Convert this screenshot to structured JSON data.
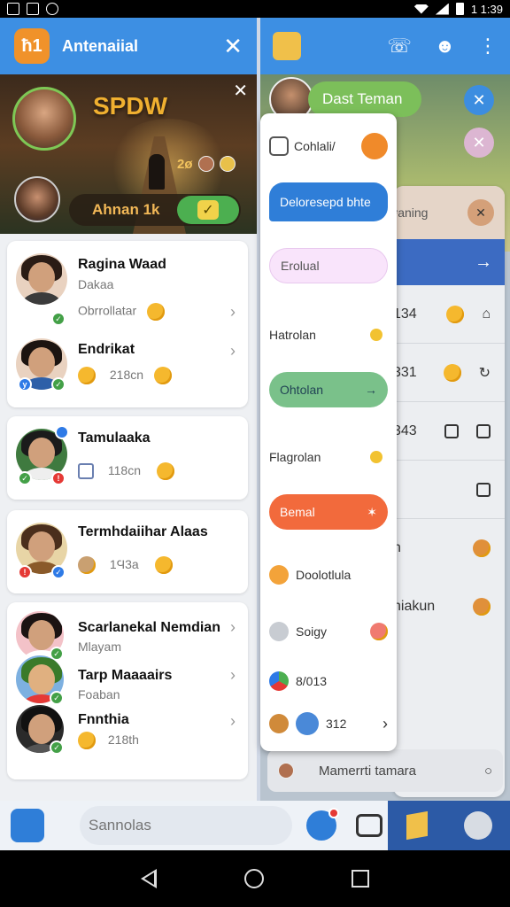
{
  "status_bar": {
    "time": "1 1:39"
  },
  "left": {
    "title": "Antenaiial",
    "logo_text": "ћ1",
    "video": {
      "overlay_word": "SPDW",
      "count": "2ø",
      "pill_text": "Ahnan 1k"
    },
    "contacts": [
      {
        "name": "Ragina Waad",
        "sub": "Dakaa",
        "line2": "Obrrollatar",
        "chev": "›"
      },
      {
        "name": "Endrikat",
        "sub_emoji": true,
        "line2": "218cn",
        "chev": "›"
      },
      {
        "name": "Tamulaaka",
        "line2": "118cn"
      },
      {
        "name": "Termhdaiihar Alaas",
        "line2": "1Ϥ3a"
      },
      {
        "name": "Scarlanekal Nemdian",
        "sub": "Mlayam",
        "chev": "›"
      },
      {
        "name": "Tarp Maaaairs",
        "sub": "Foaban",
        "chev": "›"
      },
      {
        "name": "Fnnthia",
        "line2": "218th",
        "chev": "›"
      }
    ]
  },
  "right": {
    "banner_pill": "Dast Teman",
    "side_panel": {
      "top_text": "ᵉaning",
      "rows": [
        "134",
        "331",
        "343"
      ],
      "bottom_text": "Mamerrti tamara"
    },
    "popup": {
      "items": [
        {
          "label": "Cohlali/",
          "style": "icon"
        },
        {
          "label": "Deloresepd bhte",
          "style": "blue"
        },
        {
          "label": "Erolual",
          "style": "pink"
        },
        {
          "label": "Hatrolan",
          "style": "plain"
        },
        {
          "label": "Ohtolan",
          "style": "green"
        },
        {
          "label": "Flagrolan",
          "style": "plain"
        },
        {
          "label": "Bemal",
          "style": "orange"
        },
        {
          "label": "Doolotlula",
          "style": "emoji"
        },
        {
          "label": "Soigy",
          "style": "grey"
        },
        {
          "label": "8/013",
          "style": "multi"
        },
        {
          "label": "312",
          "style": "last"
        }
      ]
    },
    "side_rows_extra": [
      "n",
      "hiakun"
    ]
  },
  "bottom_bar": {
    "search_placeholder": "Sannolas"
  },
  "colors": {
    "accent": "#3d8fe3",
    "bar_dark": "#2c5aa6",
    "green": "#43a047",
    "orange": "#f26a3c"
  }
}
